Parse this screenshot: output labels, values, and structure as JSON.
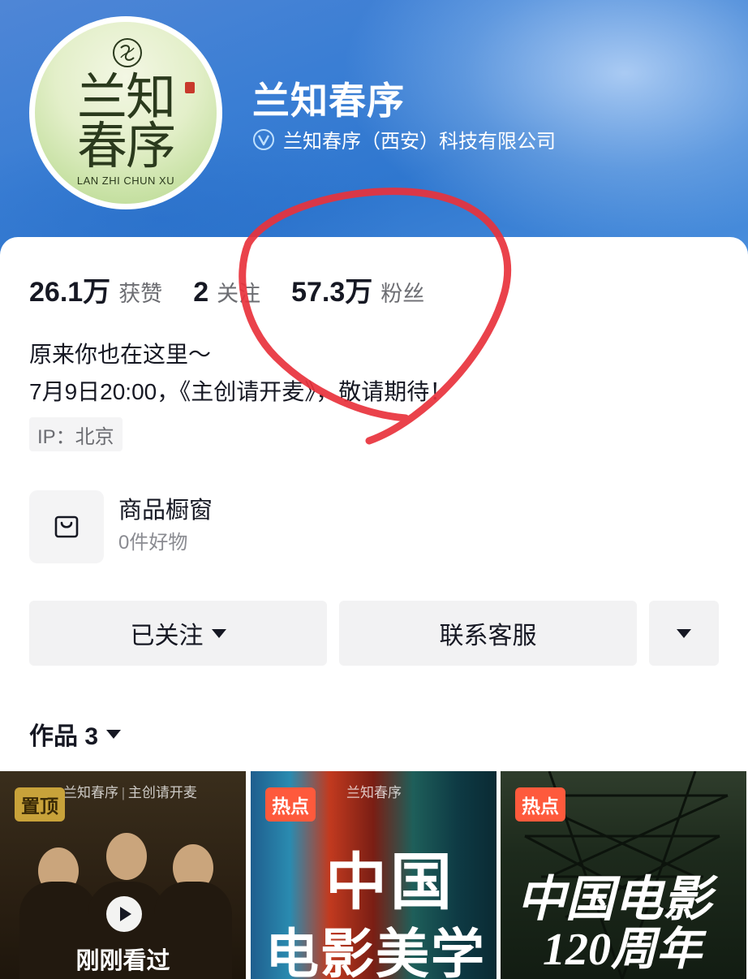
{
  "profile": {
    "name": "兰知春序",
    "verified_org": "兰知春序（西安）科技有限公司",
    "avatar": {
      "chars_line1": [
        "兰",
        "知"
      ],
      "chars_line2": [
        "春",
        "序"
      ],
      "subtitle": "LAN ZHI CHUN XU"
    }
  },
  "stats": [
    {
      "value": "26.1万",
      "label": "获赞"
    },
    {
      "value": "2",
      "label": "关注"
    },
    {
      "value": "57.3万",
      "label": "粉丝"
    }
  ],
  "bio": {
    "line1": "原来你也在这里～",
    "line2": "7月9日20:00，《主创请开麦》，敬请期待！"
  },
  "ip": "IP：北京",
  "shop": {
    "title": "商品橱窗",
    "subtitle": "0件好物",
    "icon": "shopping-bag-icon"
  },
  "buttons": {
    "follow_label": "已关注",
    "contact_label": "联系客服"
  },
  "works": {
    "label": "作品 3",
    "items": [
      {
        "badge": "置顶",
        "logo": "兰知春序 | 主创请开麦",
        "overlay": "刚刚看过",
        "play_icon": "play-icon"
      },
      {
        "badge": "热点",
        "logo": "兰知春序",
        "title_line1": "中国",
        "title_line2": "电影美学"
      },
      {
        "badge": "热点",
        "title_line1": "中国电影",
        "title_line2": "120周年"
      }
    ]
  },
  "colors": {
    "header_blue": "#3a7ed4",
    "hot_badge": "#fe5a3c",
    "annotation_red": "#e8323c"
  }
}
